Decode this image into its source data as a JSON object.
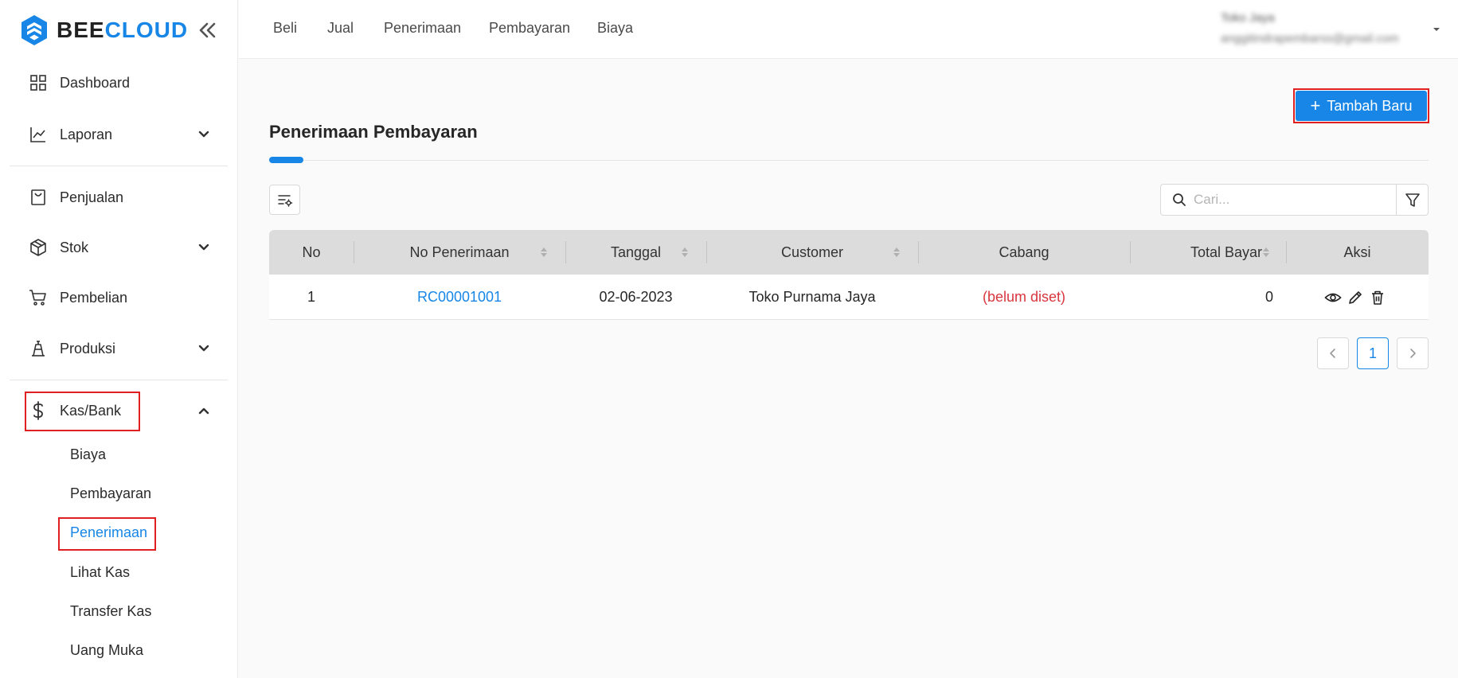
{
  "brand": {
    "name_part1": "BEE",
    "name_part2": "CLOUD",
    "accent_color": "#1786e6"
  },
  "sidebar": {
    "items": [
      {
        "label": "Dashboard",
        "icon": "dashboard-icon"
      },
      {
        "label": "Laporan",
        "icon": "chart-line-icon",
        "expandable": true
      },
      {
        "label": "Penjualan",
        "icon": "shopping-bag-icon"
      },
      {
        "label": "Stok",
        "icon": "box-icon",
        "expandable": true
      },
      {
        "label": "Pembelian",
        "icon": "cart-icon"
      },
      {
        "label": "Produksi",
        "icon": "factory-icon",
        "expandable": true
      },
      {
        "label": "Kas/Bank",
        "icon": "dollar-icon",
        "expandable": true,
        "expanded": true
      }
    ],
    "kasbank_sub": [
      "Biaya",
      "Pembayaran",
      "Penerimaan",
      "Lihat Kas",
      "Transfer Kas",
      "Uang Muka"
    ],
    "active_sub": "Penerimaan"
  },
  "topnav": [
    "Beli",
    "Jual",
    "Penerimaan",
    "Pembayaran",
    "Biaya"
  ],
  "user": {
    "name": "Toko Jaya",
    "email": "anggitindrapembarss@gmail.com"
  },
  "main": {
    "add_button": "Tambah Baru",
    "title": "Penerimaan Pembayaran",
    "search_placeholder": "Cari...",
    "columns": [
      "No",
      "No Penerimaan",
      "Tanggal",
      "Customer",
      "Cabang",
      "Total Bayar",
      "Aksi"
    ],
    "rows": [
      {
        "no": "1",
        "no_penerimaan": "RC00001001",
        "tanggal": "02-06-2023",
        "customer": "Toko Purnama Jaya",
        "cabang": "(belum diset)",
        "total_bayar": "0"
      }
    ],
    "pagination": {
      "current": "1"
    }
  }
}
